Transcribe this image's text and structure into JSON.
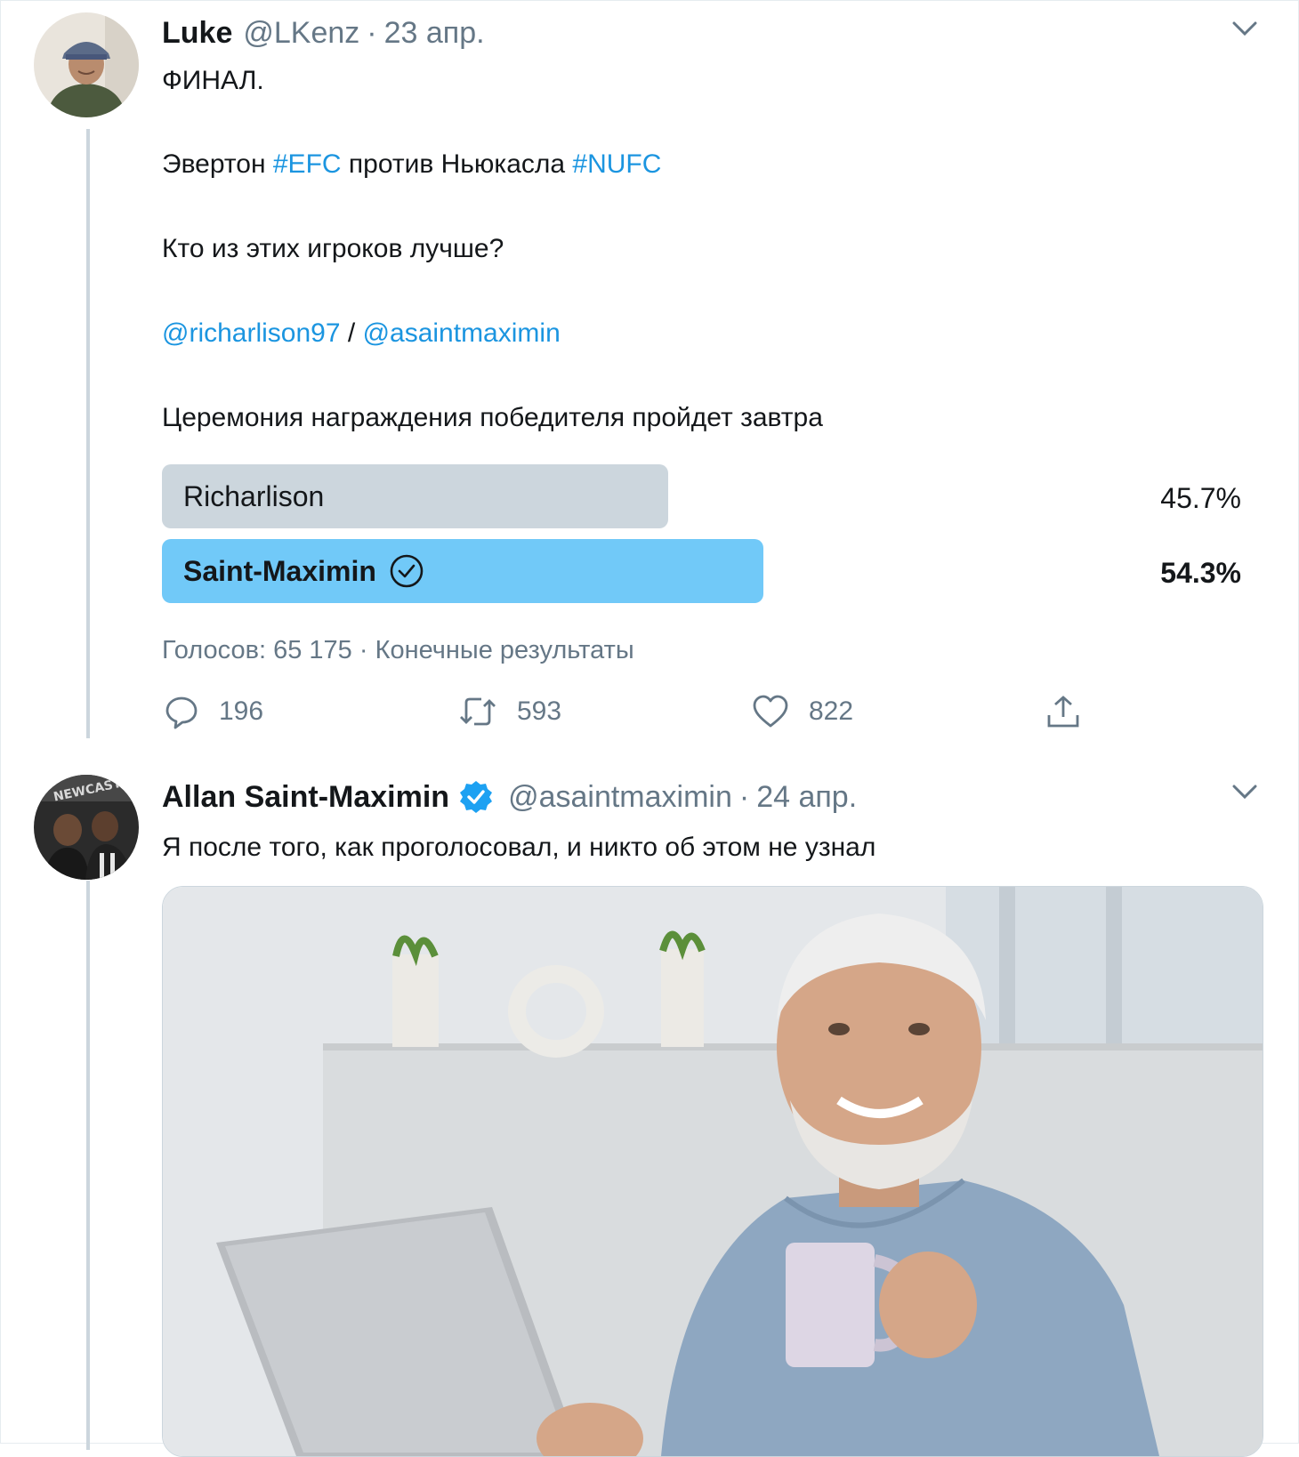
{
  "tweet1": {
    "name": "Luke",
    "handle": "@LKenz",
    "separator": "·",
    "date": "23 апр.",
    "line1": "ФИНАЛ.",
    "line2_a": "Эвертон ",
    "line2_tag1": "#EFC",
    "line2_b": " против Ньюкасла ",
    "line2_tag2": "#NUFC",
    "line3": "Кто из этих игроков лучше?",
    "mention1": "@richarlison97",
    "mention_sep": " / ",
    "mention2": "@asaintmaximin",
    "line5": "Церемония награждения победителя пройдет завтра",
    "poll": {
      "options": [
        {
          "label": "Richarlison",
          "percent_text": "45.7%",
          "percent": 45.7,
          "winner": false
        },
        {
          "label": "Saint-Maximin",
          "percent_text": "54.3%",
          "percent": 54.3,
          "winner": true
        }
      ],
      "meta": "Голосов: 65 175 · Конечные результаты"
    },
    "actions": {
      "replies": "196",
      "retweets": "593",
      "likes": "822"
    }
  },
  "tweet2": {
    "name": "Allan Saint-Maximin",
    "verified": true,
    "handle": "@asaintmaximin",
    "separator": "·",
    "date": "24 апр.",
    "text": "Я после того, как проголосовал, и никто об этом не узнал"
  },
  "colors": {
    "link": "#1b95e0",
    "poll_winner": "#71c9f8",
    "poll_other": "#ccd6dd",
    "secondary_text": "#657786",
    "thread_line": "#ccd6dd"
  },
  "icons": [
    "chevron-down-icon",
    "reply-icon",
    "retweet-icon",
    "like-icon",
    "share-icon",
    "verified-badge-icon",
    "checkmark-circle-icon"
  ]
}
